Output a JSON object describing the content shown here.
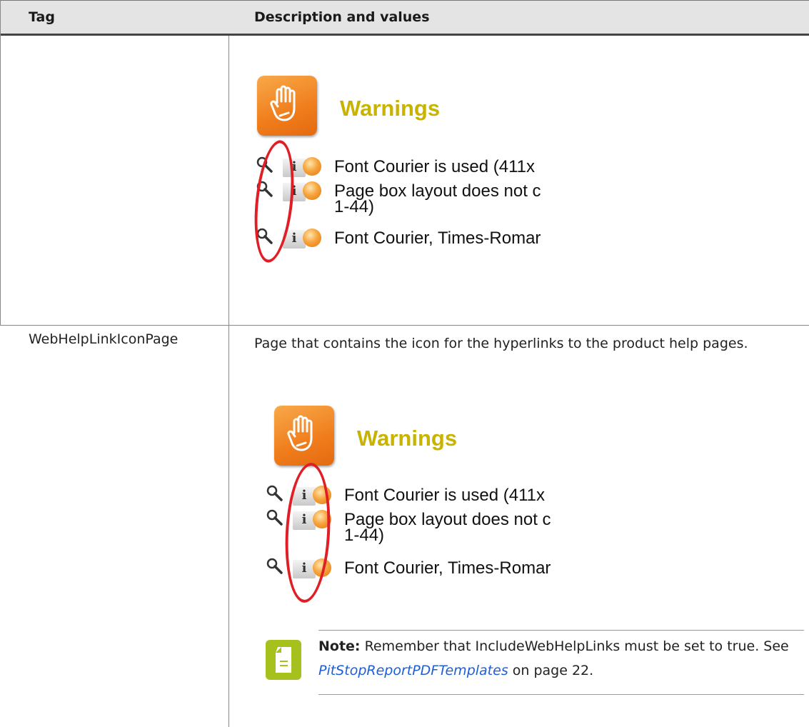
{
  "table": {
    "header": {
      "col1": "Tag",
      "col2": "Description and values"
    }
  },
  "warnings_illustration": {
    "title": "Warnings",
    "items": [
      {
        "text": "Font Courier is used (411x"
      },
      {
        "text": "Page box layout does not c"
      },
      {
        "text": "1-44)"
      },
      {
        "text": "Font Courier, Times-Romar"
      }
    ]
  },
  "row2": {
    "tag": "WebHelpLinkIconPage",
    "description": "Page that contains the icon for the hyperlinks to the product help pages."
  },
  "note": {
    "label": "Note:",
    "text_before": "Remember that IncludeWebHelpLinks must be set to true. See ",
    "link": "PitStopReportPDFTemplates",
    "text_after": " on page 22."
  },
  "colors": {
    "warning_title": "#c8b400",
    "highlight_ring": "#e01e25",
    "link": "#1e5fd8",
    "note_icon": "#a6c11d"
  }
}
